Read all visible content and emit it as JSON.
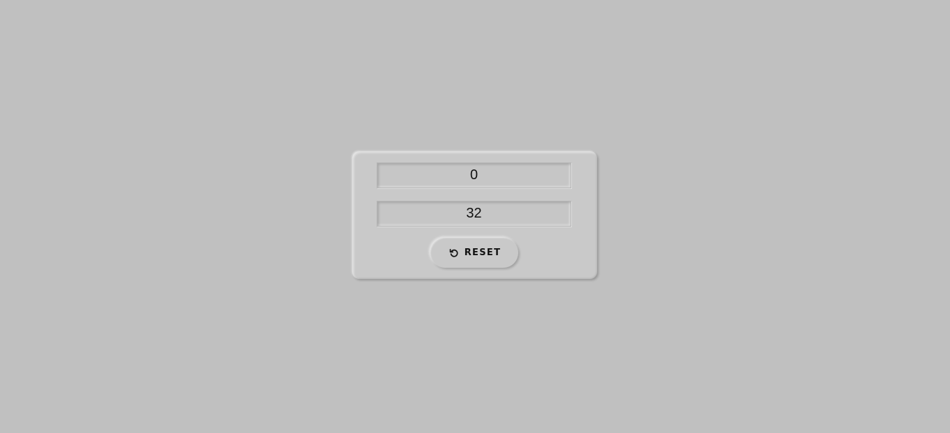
{
  "converter": {
    "field_one_value": "0",
    "field_two_value": "32"
  },
  "reset_button": {
    "label": "RESET",
    "icon": "reset-icon"
  },
  "colors": {
    "background": "#c0c0c0",
    "card": "#c9c9c9",
    "text": "#111111"
  }
}
